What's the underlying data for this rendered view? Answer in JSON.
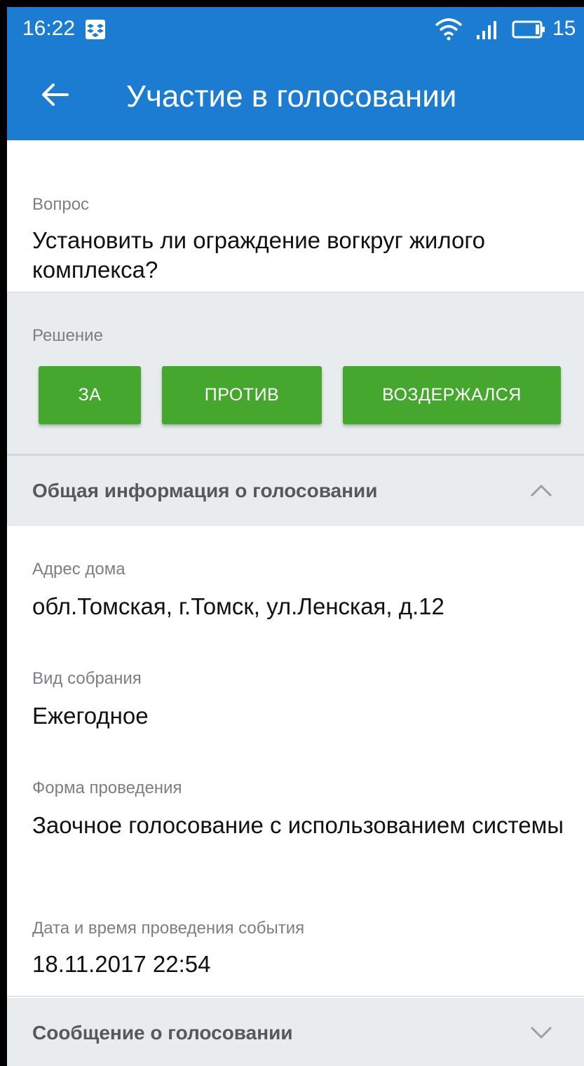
{
  "status_bar": {
    "time": "16:22",
    "battery": "15",
    "icons": [
      "dropbox-icon",
      "wifi-icon",
      "signal-icon",
      "battery-icon"
    ]
  },
  "app_bar": {
    "title": "Участие в голосовании",
    "back_icon": "arrow-left-icon"
  },
  "question": {
    "label": "Вопрос",
    "text": "Установить ли ограждение вогкруг жилого комплекса?"
  },
  "decision": {
    "label": "Решение",
    "buttons": [
      "ЗА",
      "ПРОТИВ",
      "ВОЗДЕРЖАЛСЯ"
    ]
  },
  "general_info": {
    "title": "Общая информация о голосовании",
    "expanded": true,
    "fields": [
      {
        "label": "Адрес дома",
        "value": "обл.Томская, г.Томск, ул.Ленская, д.12"
      },
      {
        "label": "Вид собрания",
        "value": "Ежегодное"
      },
      {
        "label": "Форма проведения",
        "value": "Заочное голосование с использованием системы"
      },
      {
        "label": "Дата и время проведения события",
        "value": "18.11.2017 22:54"
      }
    ]
  },
  "message_section": {
    "title": "Сообщение о голосовании",
    "expanded": false
  },
  "colors": {
    "app_bar": "#1c7cd1",
    "button": "#46a72e",
    "section_bg": "#e8ecee"
  }
}
